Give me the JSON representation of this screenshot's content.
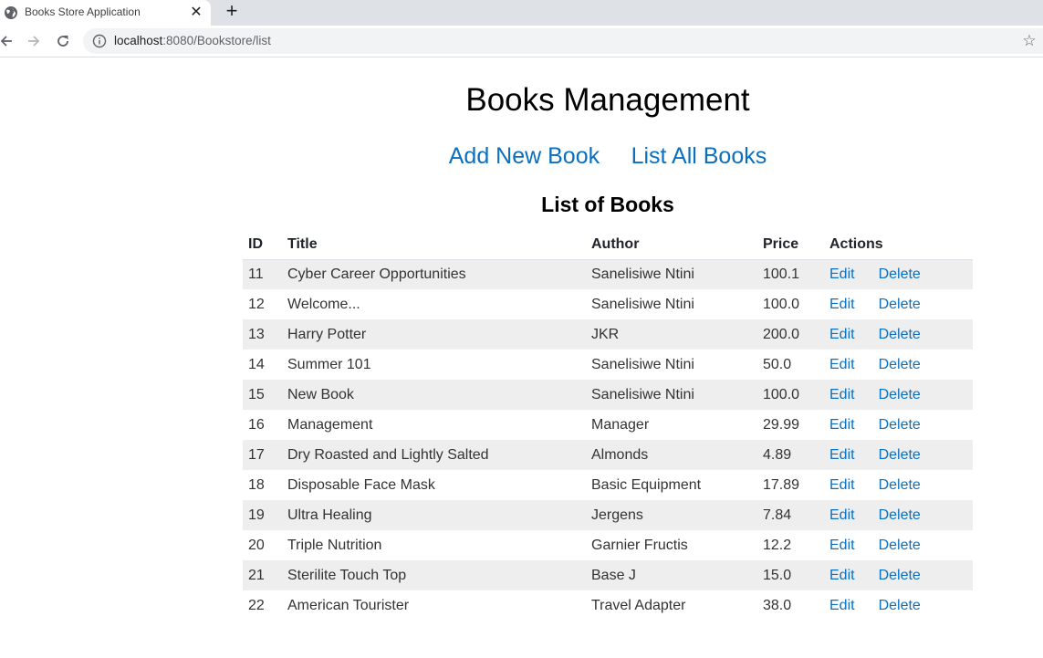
{
  "browser": {
    "tab_title": "Books Store Application",
    "url_host": "localhost",
    "url_path": ":8080/Bookstore/list"
  },
  "page": {
    "title": "Books Management",
    "links": {
      "add_new": "Add New Book",
      "list_all": "List All Books"
    },
    "list_title": "List of Books"
  },
  "table": {
    "headers": {
      "id": "ID",
      "title": "Title",
      "author": "Author",
      "price": "Price",
      "actions": "Actions"
    },
    "edit_label": "Edit",
    "delete_label": "Delete",
    "rows": [
      {
        "id": "11",
        "title": "Cyber Career Opportunities",
        "author": "Sanelisiwe Ntini",
        "price": "100.1"
      },
      {
        "id": "12",
        "title": "Welcome...",
        "author": "Sanelisiwe Ntini",
        "price": "100.0"
      },
      {
        "id": "13",
        "title": "Harry Potter",
        "author": "JKR",
        "price": "200.0"
      },
      {
        "id": "14",
        "title": "Summer 101",
        "author": "Sanelisiwe Ntini",
        "price": "50.0"
      },
      {
        "id": "15",
        "title": "New Book",
        "author": "Sanelisiwe Ntini",
        "price": "100.0"
      },
      {
        "id": "16",
        "title": "Management",
        "author": "Manager",
        "price": "29.99"
      },
      {
        "id": "17",
        "title": "Dry Roasted and Lightly Salted",
        "author": "Almonds",
        "price": "4.89"
      },
      {
        "id": "18",
        "title": "Disposable Face Mask",
        "author": "Basic Equipment",
        "price": "17.89"
      },
      {
        "id": "19",
        "title": "Ultra Healing",
        "author": "Jergens",
        "price": "7.84"
      },
      {
        "id": "20",
        "title": "Triple Nutrition",
        "author": "Garnier Fructis",
        "price": "12.2"
      },
      {
        "id": "21",
        "title": "Sterilite Touch Top",
        "author": "Base J",
        "price": "15.0"
      },
      {
        "id": "22",
        "title": "American Tourister",
        "author": "Travel Adapter",
        "price": "38.0"
      }
    ]
  },
  "colors": {
    "link": "#0b6fbf",
    "stripe": "#eeeeee",
    "tabstrip": "#dee1e6"
  }
}
